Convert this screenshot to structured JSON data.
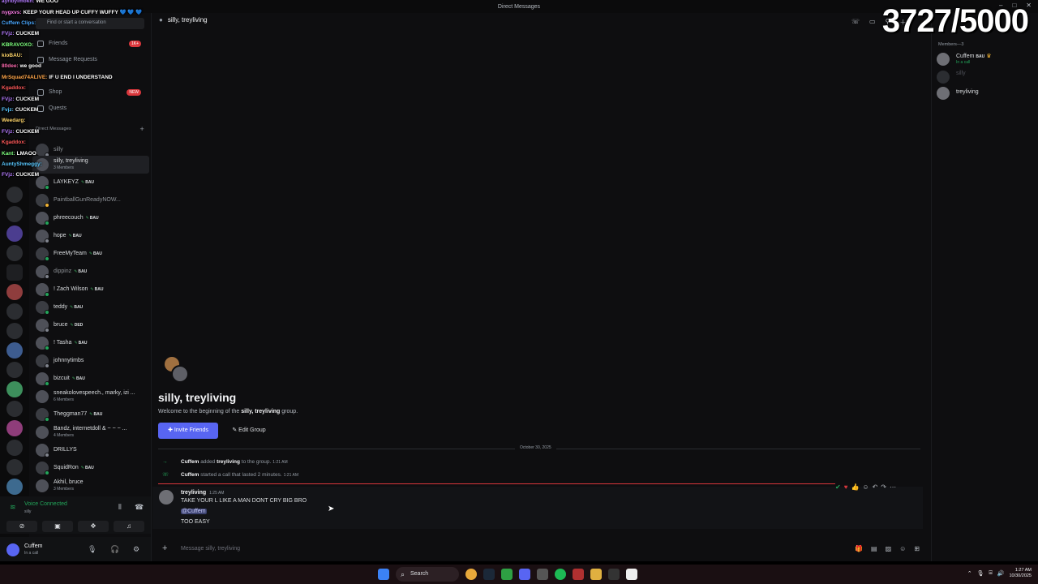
{
  "window": {
    "title": "Direct Messages"
  },
  "counter": "3727/5000",
  "sidebar": {
    "search_placeholder": "Find or start a conversation",
    "nav": [
      {
        "label": "Friends",
        "badge": "1K+"
      },
      {
        "label": "Message Requests",
        "badge": ""
      },
      {
        "label": "Shop",
        "badge": "NEW"
      },
      {
        "label": "Quests",
        "badge": ""
      }
    ],
    "dm_header": "Direct Messages",
    "dms": [
      {
        "name": "silly",
        "sub": "",
        "tag": ""
      },
      {
        "name": "silly, treyliving",
        "sub": "3 Members",
        "tag": ""
      },
      {
        "name": "LAYKEYZ",
        "sub": "",
        "tag": "BAU"
      },
      {
        "name": "PaintballGunReadyNOW...",
        "sub": "",
        "tag": ""
      },
      {
        "name": "phreecouch",
        "sub": "",
        "tag": "BAU"
      },
      {
        "name": "hope",
        "sub": "",
        "tag": "BAU"
      },
      {
        "name": "FreeMyTeam",
        "sub": "",
        "tag": "BAU"
      },
      {
        "name": "dippinz",
        "sub": "",
        "tag": "BAU"
      },
      {
        "name": "! Zach Wilson",
        "sub": "",
        "tag": "BAU"
      },
      {
        "name": "teddy",
        "sub": "",
        "tag": "BAU"
      },
      {
        "name": "bruce",
        "sub": "",
        "tag": "DED"
      },
      {
        "name": "! Tasha",
        "sub": "",
        "tag": "BAU"
      },
      {
        "name": "johnnytimbs",
        "sub": "",
        "tag": ""
      },
      {
        "name": "bizcuit",
        "sub": "",
        "tag": "BAU"
      },
      {
        "name": "sneakolovespeech., marky, izi ...",
        "sub": "6 Members",
        "tag": ""
      },
      {
        "name": "Theggman77",
        "sub": "",
        "tag": "BAU"
      },
      {
        "name": "Bandz, internetdoll & ~ ~ ~ ...",
        "sub": "4 Members",
        "tag": ""
      },
      {
        "name": "DRILLYS",
        "sub": "",
        "tag": ""
      },
      {
        "name": "SquidRon",
        "sub": "",
        "tag": "BAU"
      },
      {
        "name": "Akhil, bruce",
        "sub": "3 Members",
        "tag": ""
      }
    ]
  },
  "stream_chat": [
    {
      "user": "ayribylmokn:",
      "text": "WE GOO",
      "color": "#b57cff"
    },
    {
      "user": "nygxvs:",
      "text": "KEEP YOUR HEAD UP CUFFY WUFFY 💙 💙 💙",
      "color": "#ff7de9"
    },
    {
      "user": "Cuffem Clips:",
      "text": "",
      "color": "#4aa8ff"
    },
    {
      "user": "FVjz:",
      "text": "CUCKEM",
      "color": "#b57cff"
    },
    {
      "user": "KBRAVOXO:",
      "text": "",
      "color": "#7fff7f"
    },
    {
      "user": "kioBAU:",
      "text": "",
      "color": "#ffd66b"
    },
    {
      "user": "80dee:",
      "text": "we good",
      "color": "#ff6bb0"
    },
    {
      "user": "MrSquad74ALIVE:",
      "text": "IF U END I UNDERSTAND",
      "color": "#ffa64a"
    },
    {
      "user": "Kgaddox:",
      "text": "",
      "color": "#ff5a5a"
    },
    {
      "user": "FVjz:",
      "text": "CUCKEM",
      "color": "#b57cff"
    },
    {
      "user": "Fvjz:",
      "text": "CUCKEM",
      "color": "#5ac8ff"
    },
    {
      "user": "Weedarg:",
      "text": "",
      "color": "#ffd66b"
    },
    {
      "user": "FVjz:",
      "text": "CUCKEM",
      "color": "#b57cff"
    },
    {
      "user": "Kgaddox:",
      "text": "",
      "color": "#ff5a5a"
    },
    {
      "user": "Kant:",
      "text": "LMAOO",
      "color": "#7fff7f"
    },
    {
      "user": "AuntyShmeggy:",
      "text": "",
      "color": "#5ac8ff"
    },
    {
      "user": "FVjz:",
      "text": "CUCKEM",
      "color": "#b57cff"
    }
  ],
  "voice": {
    "status": "Voice Connected",
    "channel": "silly"
  },
  "user": {
    "name": "Cuffem",
    "status": "In a call"
  },
  "chat": {
    "header": "silly, treyliving",
    "welcome_title": "silly, treyliving",
    "welcome_pre": "Welcome to the beginning of the ",
    "welcome_bold": "silly, treyliving",
    "welcome_post": " group.",
    "invite_label": "Invite Friends",
    "edit_label": "Edit Group",
    "date": "October 30, 2025",
    "sys1": {
      "actor": "Cuffem",
      "mid": " added ",
      "target": "treyliving",
      "post": " to the group.",
      "ts": "1:21 AM"
    },
    "sys2": {
      "actor": "Cuffem",
      "mid": " started a call that lasted 2 minutes.",
      "ts": "1:21 AM"
    },
    "message": {
      "author": "treyliving",
      "ts": "1:25 AM",
      "line1": "TAKE YOUR L LIKE A MAN DONT CRY BIG BRO",
      "mention": "@Cuffem",
      "line3": "TOO EASY"
    },
    "composer_placeholder": "Message silly, treyliving"
  },
  "members": {
    "header": "Members—3",
    "list": [
      {
        "name": "Cuffem",
        "tag": "BAU",
        "status": "In a call"
      },
      {
        "name": "silly",
        "tag": "",
        "status": ""
      },
      {
        "name": "treyliving",
        "tag": "",
        "status": ""
      }
    ]
  },
  "taskbar": {
    "search_label": "Search",
    "time": "1:27 AM",
    "date": "10/30/2025"
  },
  "colors": {
    "accent": "#5865f2",
    "online": "#23a55a",
    "danger": "#da373c"
  }
}
